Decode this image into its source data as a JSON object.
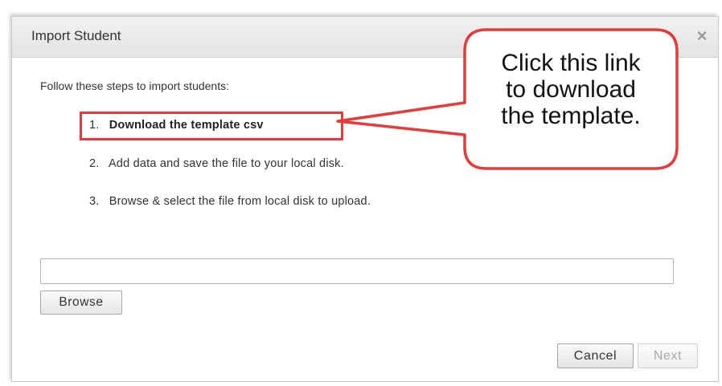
{
  "dialog": {
    "title": "Import Student",
    "close_label": "×",
    "intro": "Follow these steps to import students:",
    "steps": [
      {
        "number": "1.",
        "text": "Download the template csv"
      },
      {
        "number": "2.",
        "text": "Add data and save the file to your local disk."
      },
      {
        "number": "3.",
        "text": "Browse & select the file from local disk to upload."
      }
    ],
    "file_input": {
      "value": "",
      "placeholder": ""
    },
    "browse_label": "Browse",
    "cancel_label": "Cancel",
    "next_label": "Next"
  },
  "annotation": {
    "callout_lines": [
      "Click this link",
      "to download",
      "the template."
    ],
    "color": "#e43b3b"
  }
}
